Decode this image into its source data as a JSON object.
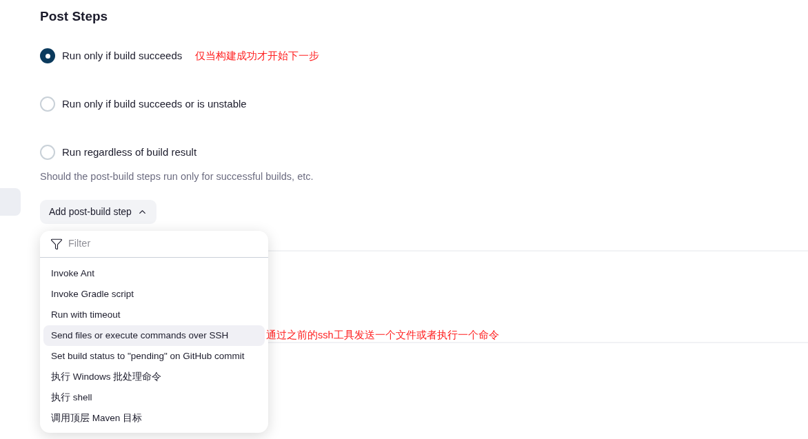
{
  "section": {
    "title": "Post Steps"
  },
  "options": [
    {
      "label": "Run only if build succeeds",
      "selected": true,
      "note": "仅当构建成功才开始下一步"
    },
    {
      "label": "Run only if build succeeds or is unstable",
      "selected": false
    },
    {
      "label": "Run regardless of build result",
      "selected": false
    }
  ],
  "description": "Should the post-build steps run only for successful builds, etc.",
  "add_button": {
    "label": "Add post-build step",
    "expanded": true
  },
  "dropdown": {
    "filter_placeholder": "Filter",
    "items": [
      {
        "label": "Invoke Ant",
        "selected": false
      },
      {
        "label": "Invoke Gradle script",
        "selected": false
      },
      {
        "label": "Run with timeout",
        "selected": false
      },
      {
        "label": "Send files or execute commands over SSH",
        "selected": true,
        "note": "通过之前的ssh工具发送一个文件或者执行一个命令"
      },
      {
        "label": "Set build status to \"pending\" on GitHub commit",
        "selected": false
      },
      {
        "label": "执行 Windows 批处理命令",
        "selected": false
      },
      {
        "label": "执行 shell",
        "selected": false
      },
      {
        "label": "调用顶层 Maven 目标",
        "selected": false
      }
    ]
  }
}
